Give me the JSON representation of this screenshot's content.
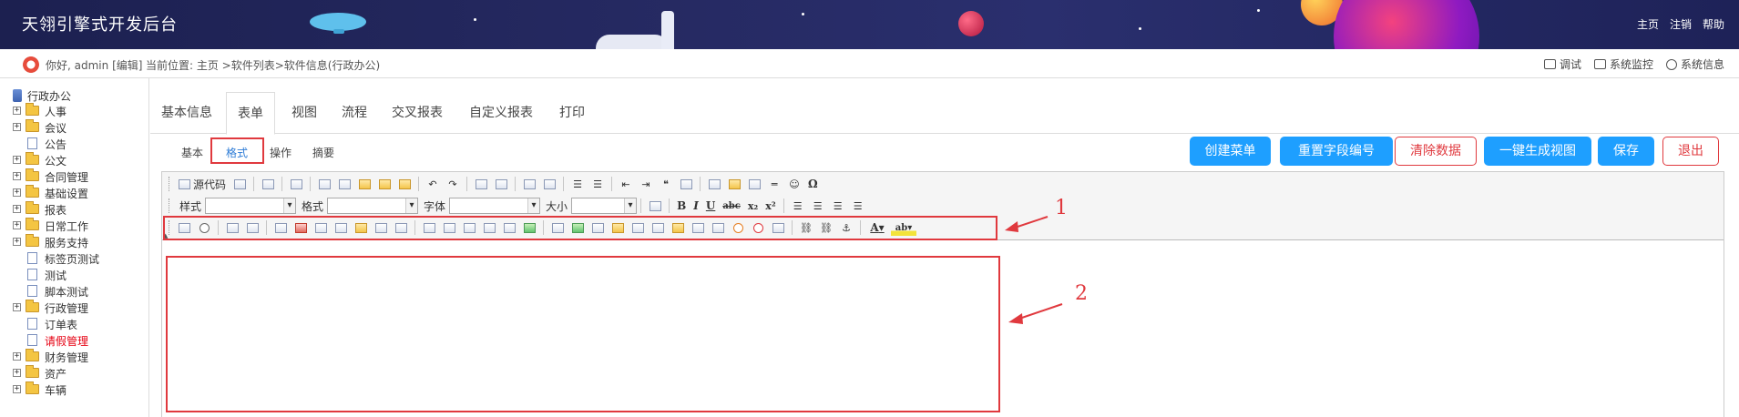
{
  "app": {
    "title": "天翎引擎式开发后台"
  },
  "top_nav": [
    "主页",
    "注销",
    "帮助"
  ],
  "user_bar": {
    "greeting": "你好, admin",
    "edit_label": "[编辑]",
    "breadcrumb": "当前位置: 主页 >软件列表>软件信息(行政办公)",
    "tools": [
      "调试",
      "系统监控",
      "系统信息"
    ]
  },
  "tree": {
    "root": "行政办公",
    "items": [
      {
        "label": "人事",
        "type": "folder",
        "expandable": true,
        "level": 0
      },
      {
        "label": "会议",
        "type": "folder",
        "expandable": true,
        "level": 0
      },
      {
        "label": "公告",
        "type": "doc",
        "expandable": false,
        "level": 0
      },
      {
        "label": "公文",
        "type": "folder",
        "expandable": true,
        "level": 0
      },
      {
        "label": "合同管理",
        "type": "folder",
        "expandable": true,
        "level": 0
      },
      {
        "label": "基础设置",
        "type": "folder",
        "expandable": true,
        "level": 0
      },
      {
        "label": "报表",
        "type": "folder",
        "expandable": true,
        "level": 0
      },
      {
        "label": "日常工作",
        "type": "folder",
        "expandable": true,
        "level": 0
      },
      {
        "label": "服务支持",
        "type": "folder",
        "expandable": true,
        "level": 0
      },
      {
        "label": "标签页测试",
        "type": "doc",
        "expandable": false,
        "level": 1
      },
      {
        "label": "测试",
        "type": "doc",
        "expandable": false,
        "level": 1
      },
      {
        "label": "脚本测试",
        "type": "doc",
        "expandable": false,
        "level": 1
      },
      {
        "label": "行政管理",
        "type": "folder",
        "expandable": true,
        "level": 0
      },
      {
        "label": "订单表",
        "type": "doc",
        "expandable": false,
        "level": 1
      },
      {
        "label": "请假管理",
        "type": "doc",
        "expandable": false,
        "level": 1,
        "active": true
      },
      {
        "label": "财务管理",
        "type": "folder",
        "expandable": true,
        "level": 0
      },
      {
        "label": "资产",
        "type": "folder",
        "expandable": true,
        "level": 0
      },
      {
        "label": "车辆",
        "type": "folder",
        "expandable": true,
        "level": 0
      }
    ]
  },
  "main_tabs": [
    "基本信息",
    "表单",
    "视图",
    "流程",
    "交叉报表",
    "自定义报表",
    "打印"
  ],
  "main_tab_active": "表单",
  "sub_tabs": [
    "基本",
    "格式",
    "操作",
    "摘要"
  ],
  "sub_tab_active": "格式",
  "actions": {
    "create_menu": "创建菜单",
    "reset_field_numbers": "重置字段编号",
    "clear_data": "清除数据",
    "generate_view": "一键生成视图",
    "save": "保存",
    "exit": "退出"
  },
  "editor": {
    "source_label": "源代码",
    "style_label": "样式",
    "format_label": "格式",
    "font_label": "字体",
    "size_label": "大小",
    "bold": "B",
    "italic": "I",
    "underline": "U",
    "strike": "abc",
    "subscript": "x₂",
    "superscript": "x²",
    "omega": "Ω",
    "text_color": "A",
    "bg_color": "ab"
  },
  "annotations": {
    "one": "1",
    "two": "2"
  },
  "colors": {
    "accent_blue": "#1e9fff",
    "danger_red": "#e0393e",
    "banner_navy": "#262a63",
    "active_tree_red": "#e60012"
  }
}
